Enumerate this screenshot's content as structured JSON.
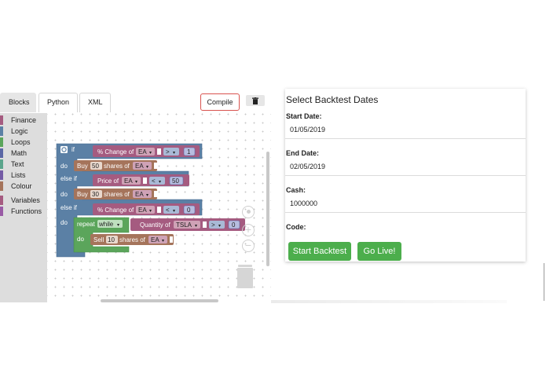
{
  "tabs": [
    {
      "label": "Blocks",
      "active": true
    },
    {
      "label": "Python",
      "active": false
    },
    {
      "label": "XML",
      "active": false
    }
  ],
  "toolbar": {
    "compile_label": "Compile",
    "delete_icon": "trash-icon"
  },
  "toolbox": {
    "categories": [
      {
        "label": "Finance",
        "color": "#a55b80"
      },
      {
        "label": "Logic",
        "color": "#5b80a5"
      },
      {
        "label": "Loops",
        "color": "#5ba55b"
      },
      {
        "label": "Math",
        "color": "#5b67a5"
      },
      {
        "label": "Text",
        "color": "#5ba58c"
      },
      {
        "label": "Lists",
        "color": "#745ba5"
      },
      {
        "label": "Colour",
        "color": "#a5745b"
      },
      {
        "label": "Variables",
        "color": "#a55b80"
      },
      {
        "label": "Functions",
        "color": "#995ba5"
      }
    ]
  },
  "blocks": {
    "if": "if",
    "do": "do",
    "else_if": "else if",
    "cond1": {
      "label": "% Change of",
      "stock": "EA",
      "op": ">",
      "value": "1"
    },
    "action1": {
      "buy": "Buy",
      "qty": "50",
      "shares_of": "shares of",
      "stock": "EA"
    },
    "cond2": {
      "label": "Price of",
      "stock": "EA",
      "op": "<",
      "value": "50"
    },
    "action2": {
      "buy": "Buy",
      "qty": "30",
      "shares_of": "shares of",
      "stock": "EA"
    },
    "cond3": {
      "label": "% Change of",
      "stock": "EA",
      "op": "<",
      "value": "0"
    },
    "repeat": {
      "label": "repeat",
      "mode": "while"
    },
    "cond4": {
      "label": "Quantity of",
      "stock": "TSLA",
      "op": ">",
      "value": "0"
    },
    "action3": {
      "sell": "Sell",
      "qty": "10",
      "shares_of": "shares of",
      "stock": "EA"
    }
  },
  "form": {
    "title": "Select Backtest Dates",
    "start_label": "Start Date:",
    "start_value": "01/05/2019",
    "end_label": "End Date:",
    "end_value": "02/05/2019",
    "cash_label": "Cash:",
    "cash_value": "1000000",
    "code_label": "Code:",
    "start_backtest": "Start Backtest",
    "go_live": "Go Live!"
  },
  "colors": {
    "logic": "#5b80a5",
    "finance": "#a55b80",
    "loops": "#5ba55b",
    "math": "#5b67a5",
    "brown": "#a5745b",
    "green_button": "#4cae4c",
    "compile_border": "#d9534f"
  }
}
